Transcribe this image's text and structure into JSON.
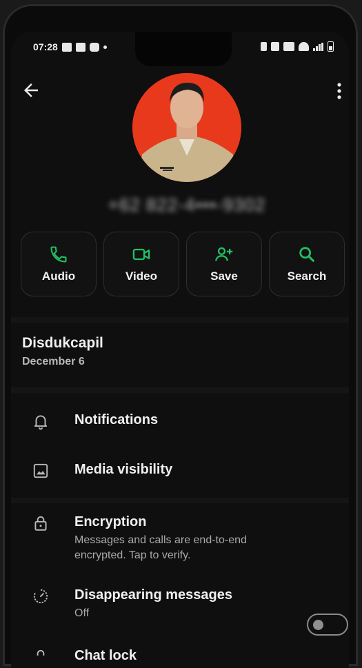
{
  "status_bar": {
    "time": "07:28"
  },
  "contact": {
    "phone_number": "+62 822-4•••-9302"
  },
  "actions": [
    {
      "label": "Audio",
      "icon": "phone-icon"
    },
    {
      "label": "Video",
      "icon": "video-icon"
    },
    {
      "label": "Save",
      "icon": "add-person-icon"
    },
    {
      "label": "Search",
      "icon": "search-icon"
    }
  ],
  "about": {
    "name": "Disdukcapil",
    "date": "December 6"
  },
  "settings": {
    "notifications": {
      "title": "Notifications"
    },
    "media_visibility": {
      "title": "Media visibility"
    },
    "encryption": {
      "title": "Encryption",
      "subtitle": "Messages and calls are end-to-end encrypted. Tap to verify."
    },
    "disappearing": {
      "title": "Disappearing messages",
      "subtitle": "Off"
    },
    "chat_lock": {
      "title": "Chat lock",
      "enabled": false
    }
  },
  "colors": {
    "accent": "#21c063",
    "avatar_background": "#e8391d",
    "background": "#0f0f0f"
  }
}
